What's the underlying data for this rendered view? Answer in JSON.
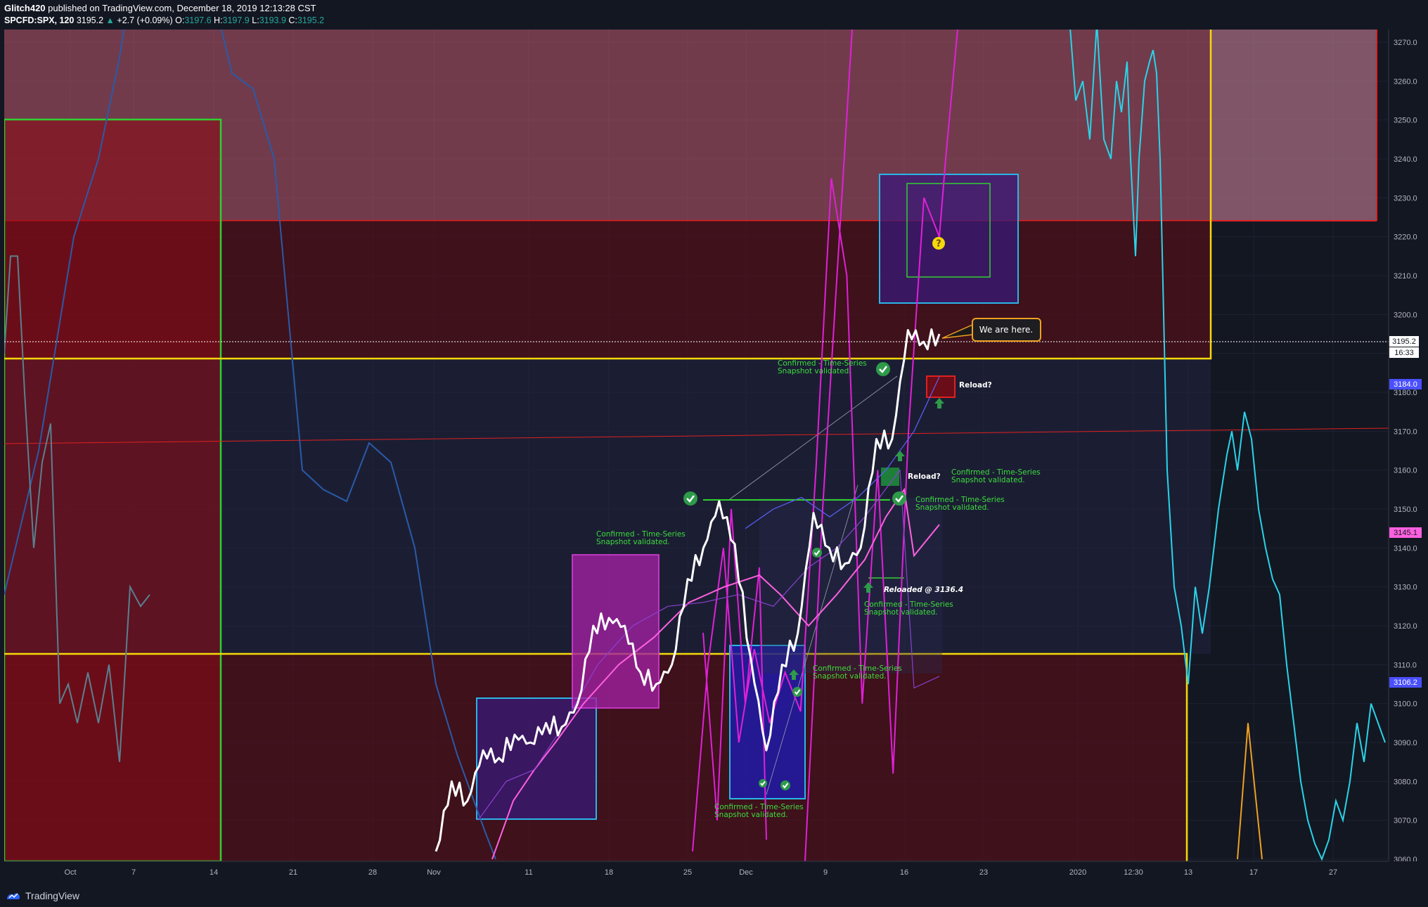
{
  "header": {
    "author": "Glitch420",
    "published": "published on TradingView.com, December 18, 2019 12:13:28 CST",
    "symbol": "SPCFD:SPX, 120",
    "last": "3195.2",
    "change": "+2.7 (+0.09%)",
    "o_label": "O:",
    "o": "3197.6",
    "h_label": "H:",
    "h": "3197.9",
    "l_label": "L:",
    "l": "3193.9",
    "c_label": "C:",
    "c": "3195.2"
  },
  "footer": {
    "brand": "TradingView",
    "logo_icon": "tradingview-logo-icon"
  },
  "colors": {
    "background": "#131722",
    "price": "#ffffff",
    "cyan": "#29d4e8",
    "magenta": "#e020d8",
    "yellow": "#f5d90a",
    "red": "#e02020",
    "green": "#30d030",
    "annotation": "#3ddc3d"
  },
  "price_labels": {
    "last": "3195.2",
    "countdown": "16:33",
    "blue_1": "3184.0",
    "magenta": "3145.1",
    "blue_2": "3106.2"
  },
  "annotations": {
    "we_are_here": "We are here.",
    "reload_1": "Reload?",
    "reload_2": "Reload?",
    "reloaded": "Reloaded @ 3136.4",
    "confirmed_line1": "Confirmed - Time-Series",
    "confirmed_line2": "Snapshot validated."
  },
  "chart_data": {
    "type": "line",
    "symbol": "SPCFD:SPX",
    "interval": "120",
    "y_axis": {
      "min": 3060,
      "max": 3270,
      "step": 10,
      "ticks": [
        3060.0,
        3070.0,
        3080.0,
        3090.0,
        3100.0,
        3110.0,
        3120.0,
        3130.0,
        3140.0,
        3150.0,
        3160.0,
        3170.0,
        3180.0,
        3190.0,
        3200.0,
        3210.0,
        3220.0,
        3230.0,
        3240.0,
        3250.0,
        3260.0,
        3270.0
      ]
    },
    "x_axis": {
      "ticks": [
        "Oct",
        "7",
        "14",
        "21",
        "28",
        "Nov",
        "11",
        "18",
        "25",
        "Dec",
        "9",
        "16",
        "23",
        "2020",
        "12:30",
        "13",
        "17",
        "27"
      ]
    },
    "series": [
      {
        "color": "#ffffff",
        "x": [
          "Nov 1",
          "Nov 4",
          "Nov 5",
          "Nov 6",
          "Nov 7",
          "Nov 8",
          "Nov 11",
          "Nov 12",
          "Nov 13",
          "Nov 14",
          "Nov 15",
          "Nov 18",
          "Nov 19",
          "Nov 20",
          "Nov 21",
          "Nov 22",
          "Nov 25",
          "Nov 26",
          "Nov 27",
          "Nov 29",
          "Dec 2",
          "Dec 3",
          "Dec 4",
          "Dec 5",
          "Dec 6",
          "Dec 9",
          "Dec 10",
          "Dec 11",
          "Dec 12",
          "Dec 13",
          "Dec 16",
          "Dec 17",
          "Dec 18"
        ],
        "values": [
          3062,
          3080,
          3075,
          3088,
          3086,
          3092,
          3090,
          3095,
          3094,
          3100,
          3120,
          3122,
          3120,
          3108,
          3105,
          3110,
          3132,
          3140,
          3152,
          3141,
          3112,
          3088,
          3110,
          3118,
          3149,
          3140,
          3136,
          3140,
          3168,
          3168,
          3196,
          3193,
          3195
        ]
      },
      {
        "color": "#e020d8",
        "x": [
          "Nov 25",
          "Nov 26",
          "Nov 27",
          "Nov 29",
          "Dec 2",
          "Dec 3",
          "Dec 4",
          "Dec 5",
          "Dec 6",
          "Dec 9",
          "Dec 10",
          "Dec 11",
          "Dec 12",
          "Dec 13",
          "Dec 16",
          "Dec 17",
          "Dec 18"
        ],
        "values": [
          3062,
          3110,
          3140,
          3090,
          3114,
          3095,
          3108,
          3098,
          3160,
          3235,
          3210,
          3100,
          3160,
          3082,
          3170,
          3230,
          3220
        ]
      }
    ],
    "ylim": [
      3060,
      3270
    ]
  }
}
